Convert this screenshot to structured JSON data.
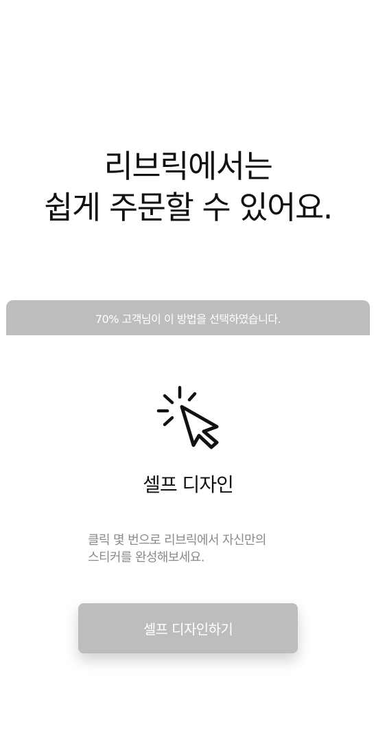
{
  "headline": {
    "line1": "리브릭에서는",
    "line2": "쉽게 주문할 수 있어요."
  },
  "banner": {
    "text": "70% 고객님이 이 방법을 선택하였습니다."
  },
  "option": {
    "icon": "click-cursor-icon",
    "title": "셀프 디자인",
    "desc_line1": "클릭 몇 번으로 리브릭에서 자신만의",
    "desc_line2": "스티커를 완성해보세요."
  },
  "cta": {
    "label": "셀프 디자인하기"
  },
  "colors": {
    "banner_bg": "#bdbdbd",
    "button_bg": "#bdbdbd",
    "text_primary": "#111111",
    "text_secondary": "#8a8a8a"
  }
}
